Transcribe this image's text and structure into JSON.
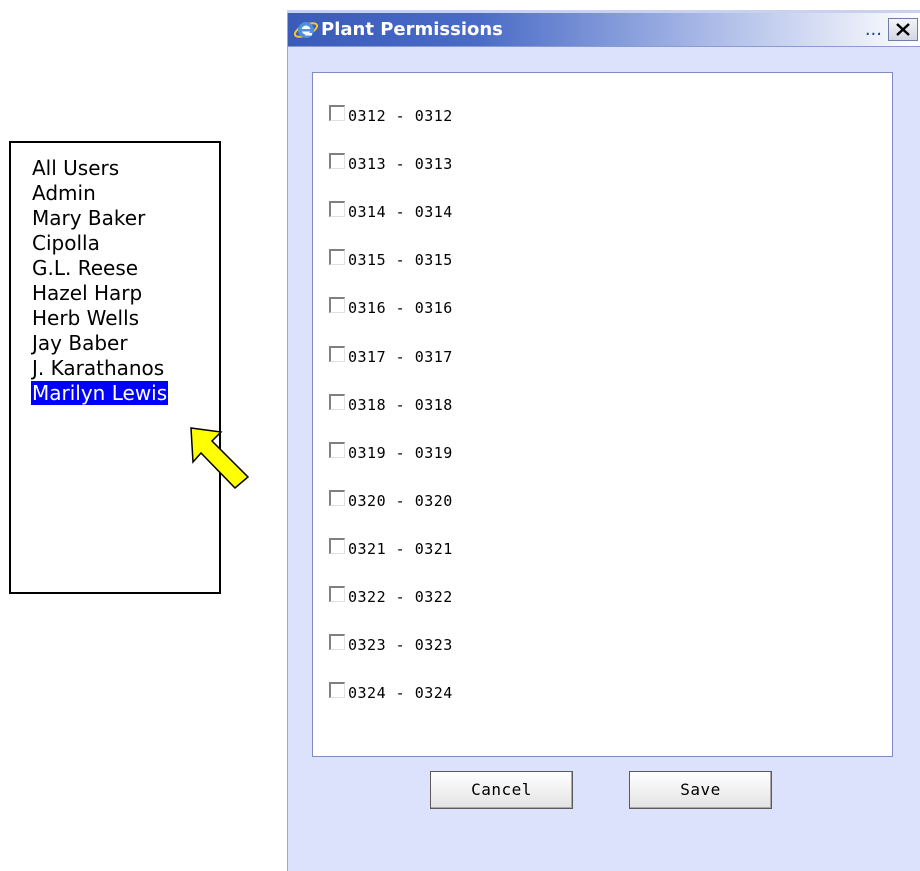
{
  "users": {
    "items": [
      "All Users",
      "Admin",
      "Mary Baker",
      "Cipolla",
      "G.L. Reese",
      "Hazel Harp",
      "Herb Wells",
      "Jay Baber",
      "J. Karathanos",
      "Marilyn Lewis"
    ],
    "selected": "Marilyn Lewis",
    "selected_highlight_color": "#0000ff"
  },
  "pointer": {
    "icon": "arrow-pointer-icon",
    "color": "#ffff00"
  },
  "dialog": {
    "title": "Plant Permissions",
    "more_label": "...",
    "close_label": "X",
    "title_bar_color": "#3a5bb8",
    "background_color": "#dce2fb",
    "permissions": [
      "0312 - 0312",
      "0313 - 0313",
      "0314 - 0314",
      "0315 - 0315",
      "0316 - 0316",
      "0317 - 0317",
      "0318 - 0318",
      "0319 - 0319",
      "0320 - 0320",
      "0321 - 0321",
      "0322 - 0322",
      "0323 - 0323",
      "0324 - 0324"
    ],
    "buttons": {
      "cancel": "Cancel",
      "save": "Save"
    }
  }
}
